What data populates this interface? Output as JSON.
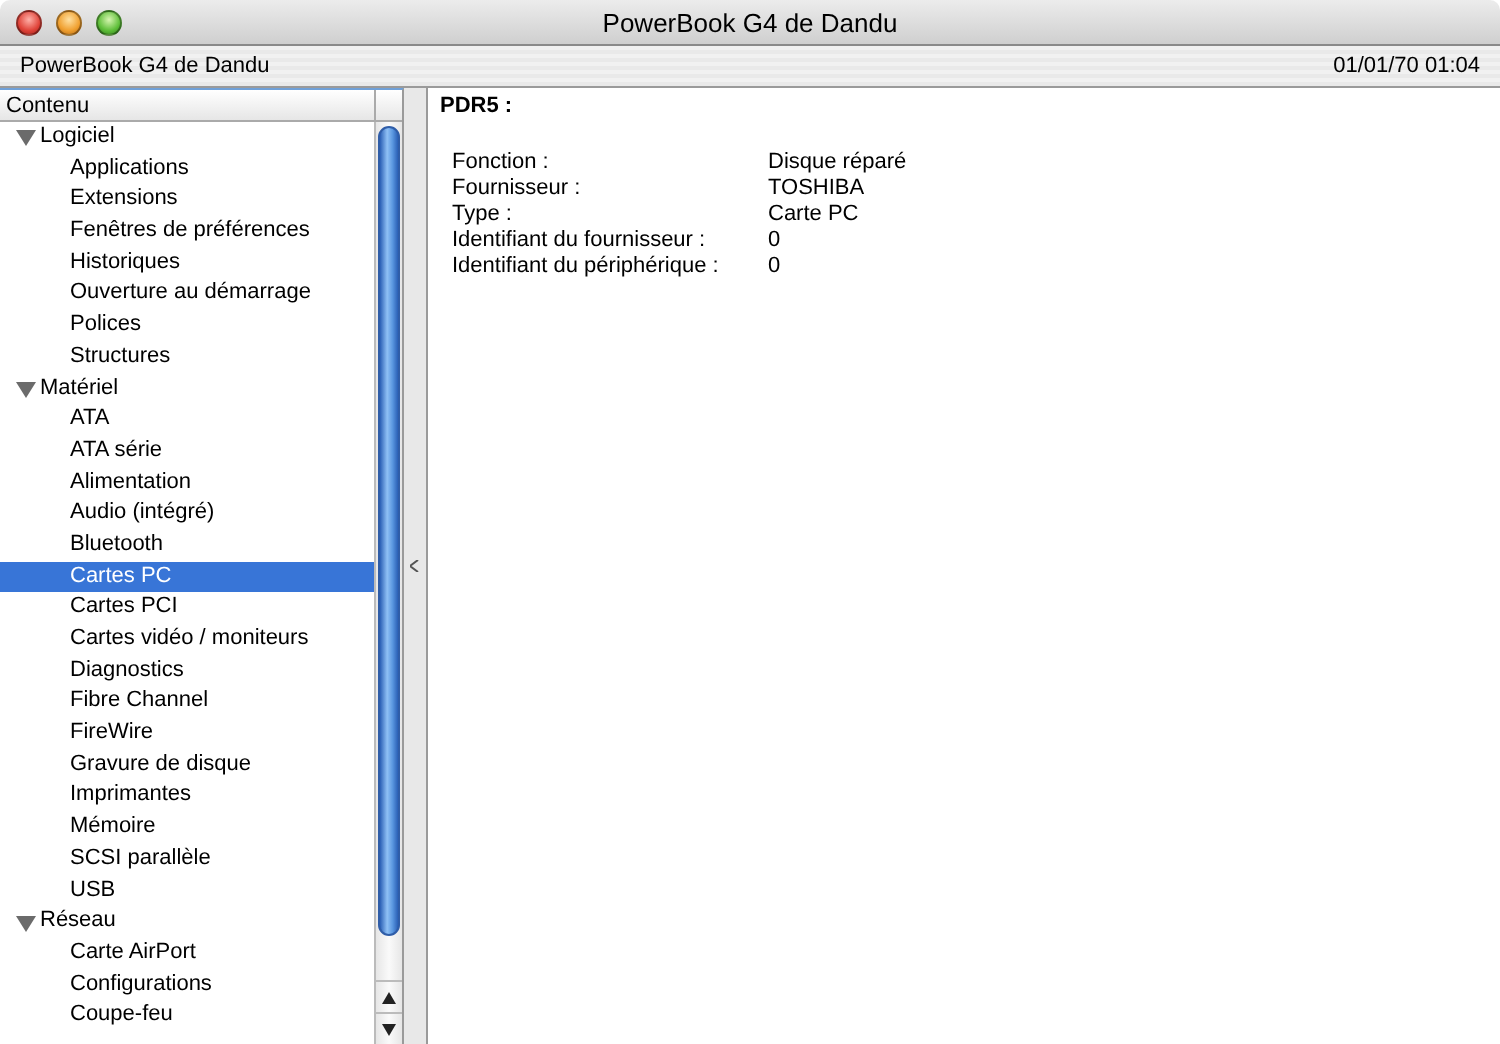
{
  "window": {
    "title": "PowerBook G4 de Dandu"
  },
  "info_bar": {
    "computer": "PowerBook G4 de Dandu",
    "date": "01/01/70 01:04"
  },
  "sidebar": {
    "header": "Contenu",
    "items": [
      {
        "label": "Logiciel",
        "expanded": true,
        "selected": false,
        "children": [
          {
            "label": "Applications",
            "selected": false
          },
          {
            "label": "Extensions",
            "selected": false
          },
          {
            "label": "Fenêtres de préférences",
            "selected": false
          },
          {
            "label": "Historiques",
            "selected": false
          },
          {
            "label": "Ouverture au démarrage",
            "selected": false
          },
          {
            "label": "Polices",
            "selected": false
          },
          {
            "label": "Structures",
            "selected": false
          }
        ]
      },
      {
        "label": "Matériel",
        "expanded": true,
        "selected": false,
        "children": [
          {
            "label": "ATA",
            "selected": false
          },
          {
            "label": "ATA série",
            "selected": false
          },
          {
            "label": "Alimentation",
            "selected": false
          },
          {
            "label": "Audio (intégré)",
            "selected": false
          },
          {
            "label": "Bluetooth",
            "selected": false
          },
          {
            "label": "Cartes PC",
            "selected": true
          },
          {
            "label": "Cartes PCI",
            "selected": false
          },
          {
            "label": "Cartes vidéo / moniteurs",
            "selected": false
          },
          {
            "label": "Diagnostics",
            "selected": false
          },
          {
            "label": "Fibre Channel",
            "selected": false
          },
          {
            "label": "FireWire",
            "selected": false
          },
          {
            "label": "Gravure de disque",
            "selected": false
          },
          {
            "label": "Imprimantes",
            "selected": false
          },
          {
            "label": "Mémoire",
            "selected": false
          },
          {
            "label": "SCSI parallèle",
            "selected": false
          },
          {
            "label": "USB",
            "selected": false
          }
        ]
      },
      {
        "label": "Réseau",
        "expanded": true,
        "selected": false,
        "children": [
          {
            "label": "Carte AirPort",
            "selected": false
          },
          {
            "label": "Configurations",
            "selected": false
          },
          {
            "label": "Coupe-feu",
            "selected": false
          }
        ]
      }
    ]
  },
  "detail": {
    "heading": "PDR5 :",
    "properties": [
      {
        "key": "Fonction :",
        "value": "Disque réparé"
      },
      {
        "key": "Fournisseur :",
        "value": "TOSHIBA"
      },
      {
        "key": "Type :",
        "value": "Carte PC"
      },
      {
        "key": "Identifiant du fournisseur :",
        "value": "0"
      },
      {
        "key": "Identifiant du périphérique :",
        "value": "0"
      }
    ]
  }
}
